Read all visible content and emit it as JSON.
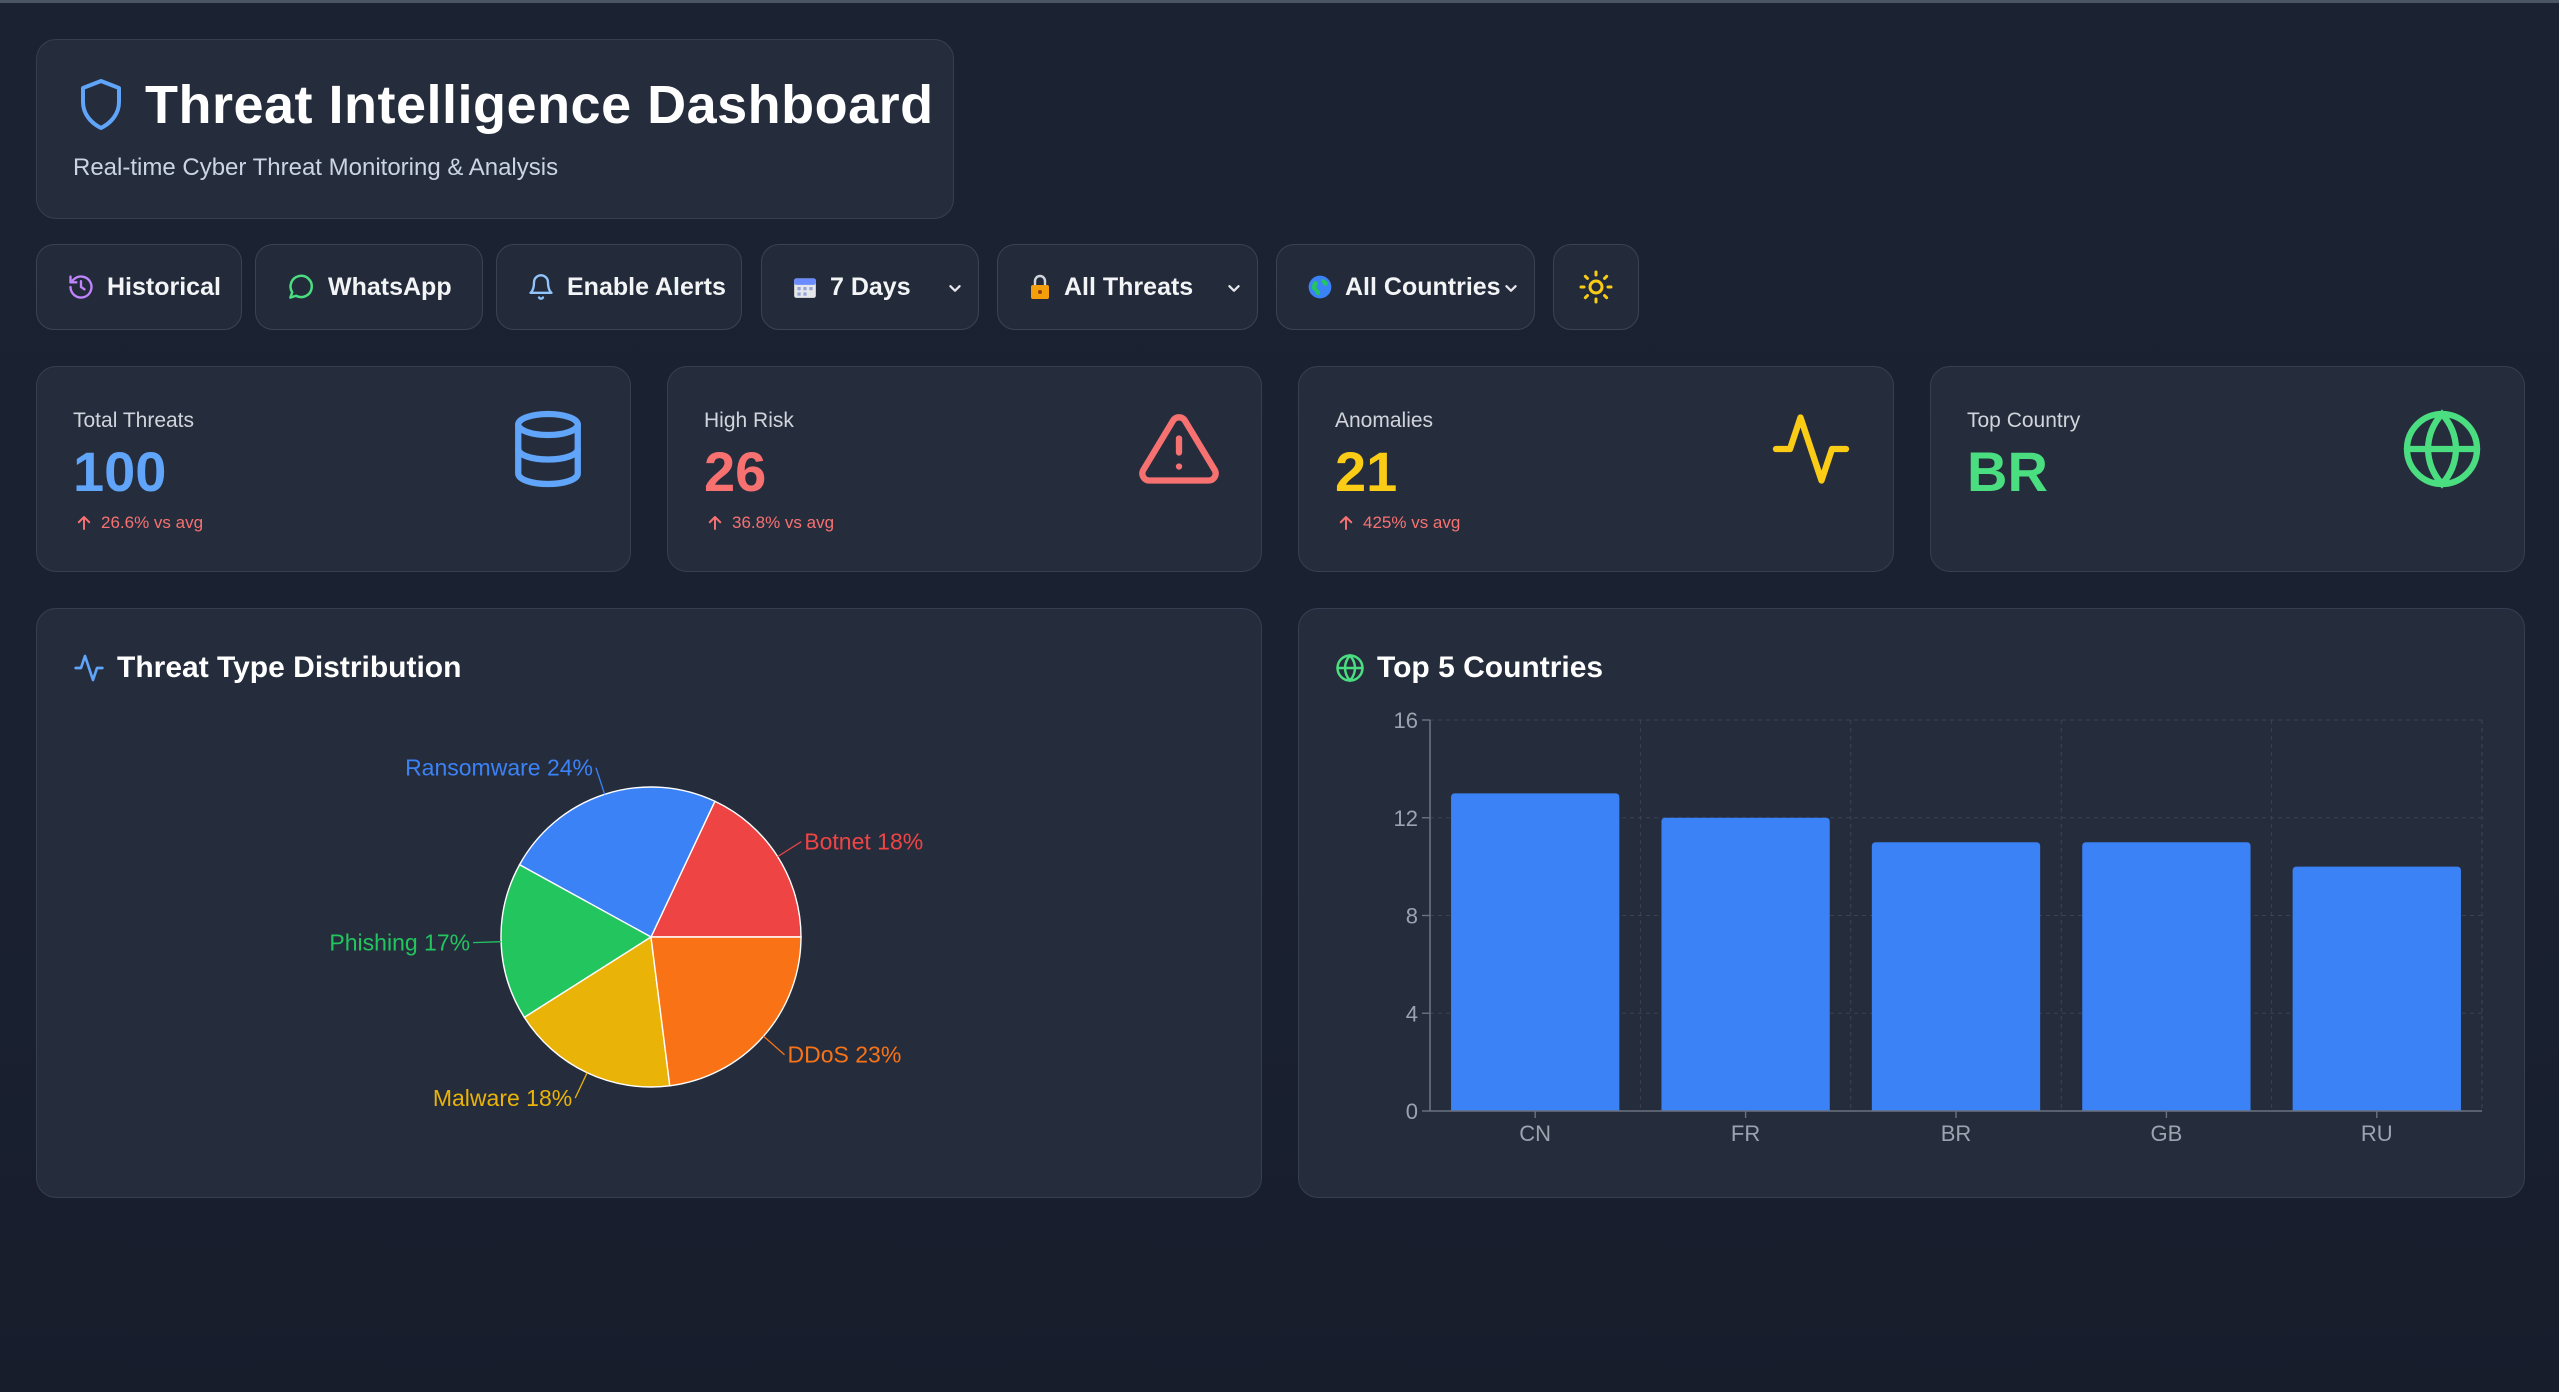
{
  "header": {
    "title": "Threat Intelligence Dashboard",
    "subtitle": "Real-time Cyber Threat Monitoring & Analysis"
  },
  "toolbar": {
    "historical": "Historical",
    "whatsapp": "WhatsApp",
    "alerts": "Enable Alerts",
    "range": "7 Days",
    "threats": "All Threats",
    "countries": "All Countries"
  },
  "stats": [
    {
      "label": "Total Threats",
      "value": "100",
      "trend": "26.6% vs avg",
      "color": "#60a5fa",
      "icon": "database-icon"
    },
    {
      "label": "High Risk",
      "value": "26",
      "trend": "36.8% vs avg",
      "color": "#f87171",
      "icon": "warning-triangle-icon"
    },
    {
      "label": "Anomalies",
      "value": "21",
      "trend": "425% vs avg",
      "color": "#facc15",
      "icon": "activity-icon"
    },
    {
      "label": "Top Country",
      "value": "BR",
      "color": "#4ade80",
      "icon": "globe-icon"
    }
  ],
  "charts": {
    "pie_title": "Threat Type Distribution",
    "bar_title": "Top 5 Countries"
  },
  "chart_data": [
    {
      "type": "pie",
      "title": "Threat Type Distribution",
      "slices": [
        {
          "name": "Botnet",
          "value": 18,
          "label": "Botnet 18%",
          "color": "#ef4444"
        },
        {
          "name": "Ransomware",
          "value": 24,
          "label": "Ransomware 24%",
          "color": "#3b82f6"
        },
        {
          "name": "Phishing",
          "value": 17,
          "label": "Phishing 17%",
          "color": "#22c55e"
        },
        {
          "name": "Malware",
          "value": 18,
          "label": "Malware 18%",
          "color": "#eab308"
        },
        {
          "name": "DDoS",
          "value": 23,
          "label": "DDoS 23%",
          "color": "#f97316"
        }
      ]
    },
    {
      "type": "bar",
      "title": "Top 5 Countries",
      "categories": [
        "CN",
        "FR",
        "BR",
        "GB",
        "RU"
      ],
      "values": [
        13,
        12,
        11,
        11,
        10
      ],
      "ylim": [
        0,
        16
      ],
      "yticks": [
        0,
        4,
        8,
        12,
        16
      ],
      "bar_color": "#3b82f6",
      "grid": true
    }
  ]
}
